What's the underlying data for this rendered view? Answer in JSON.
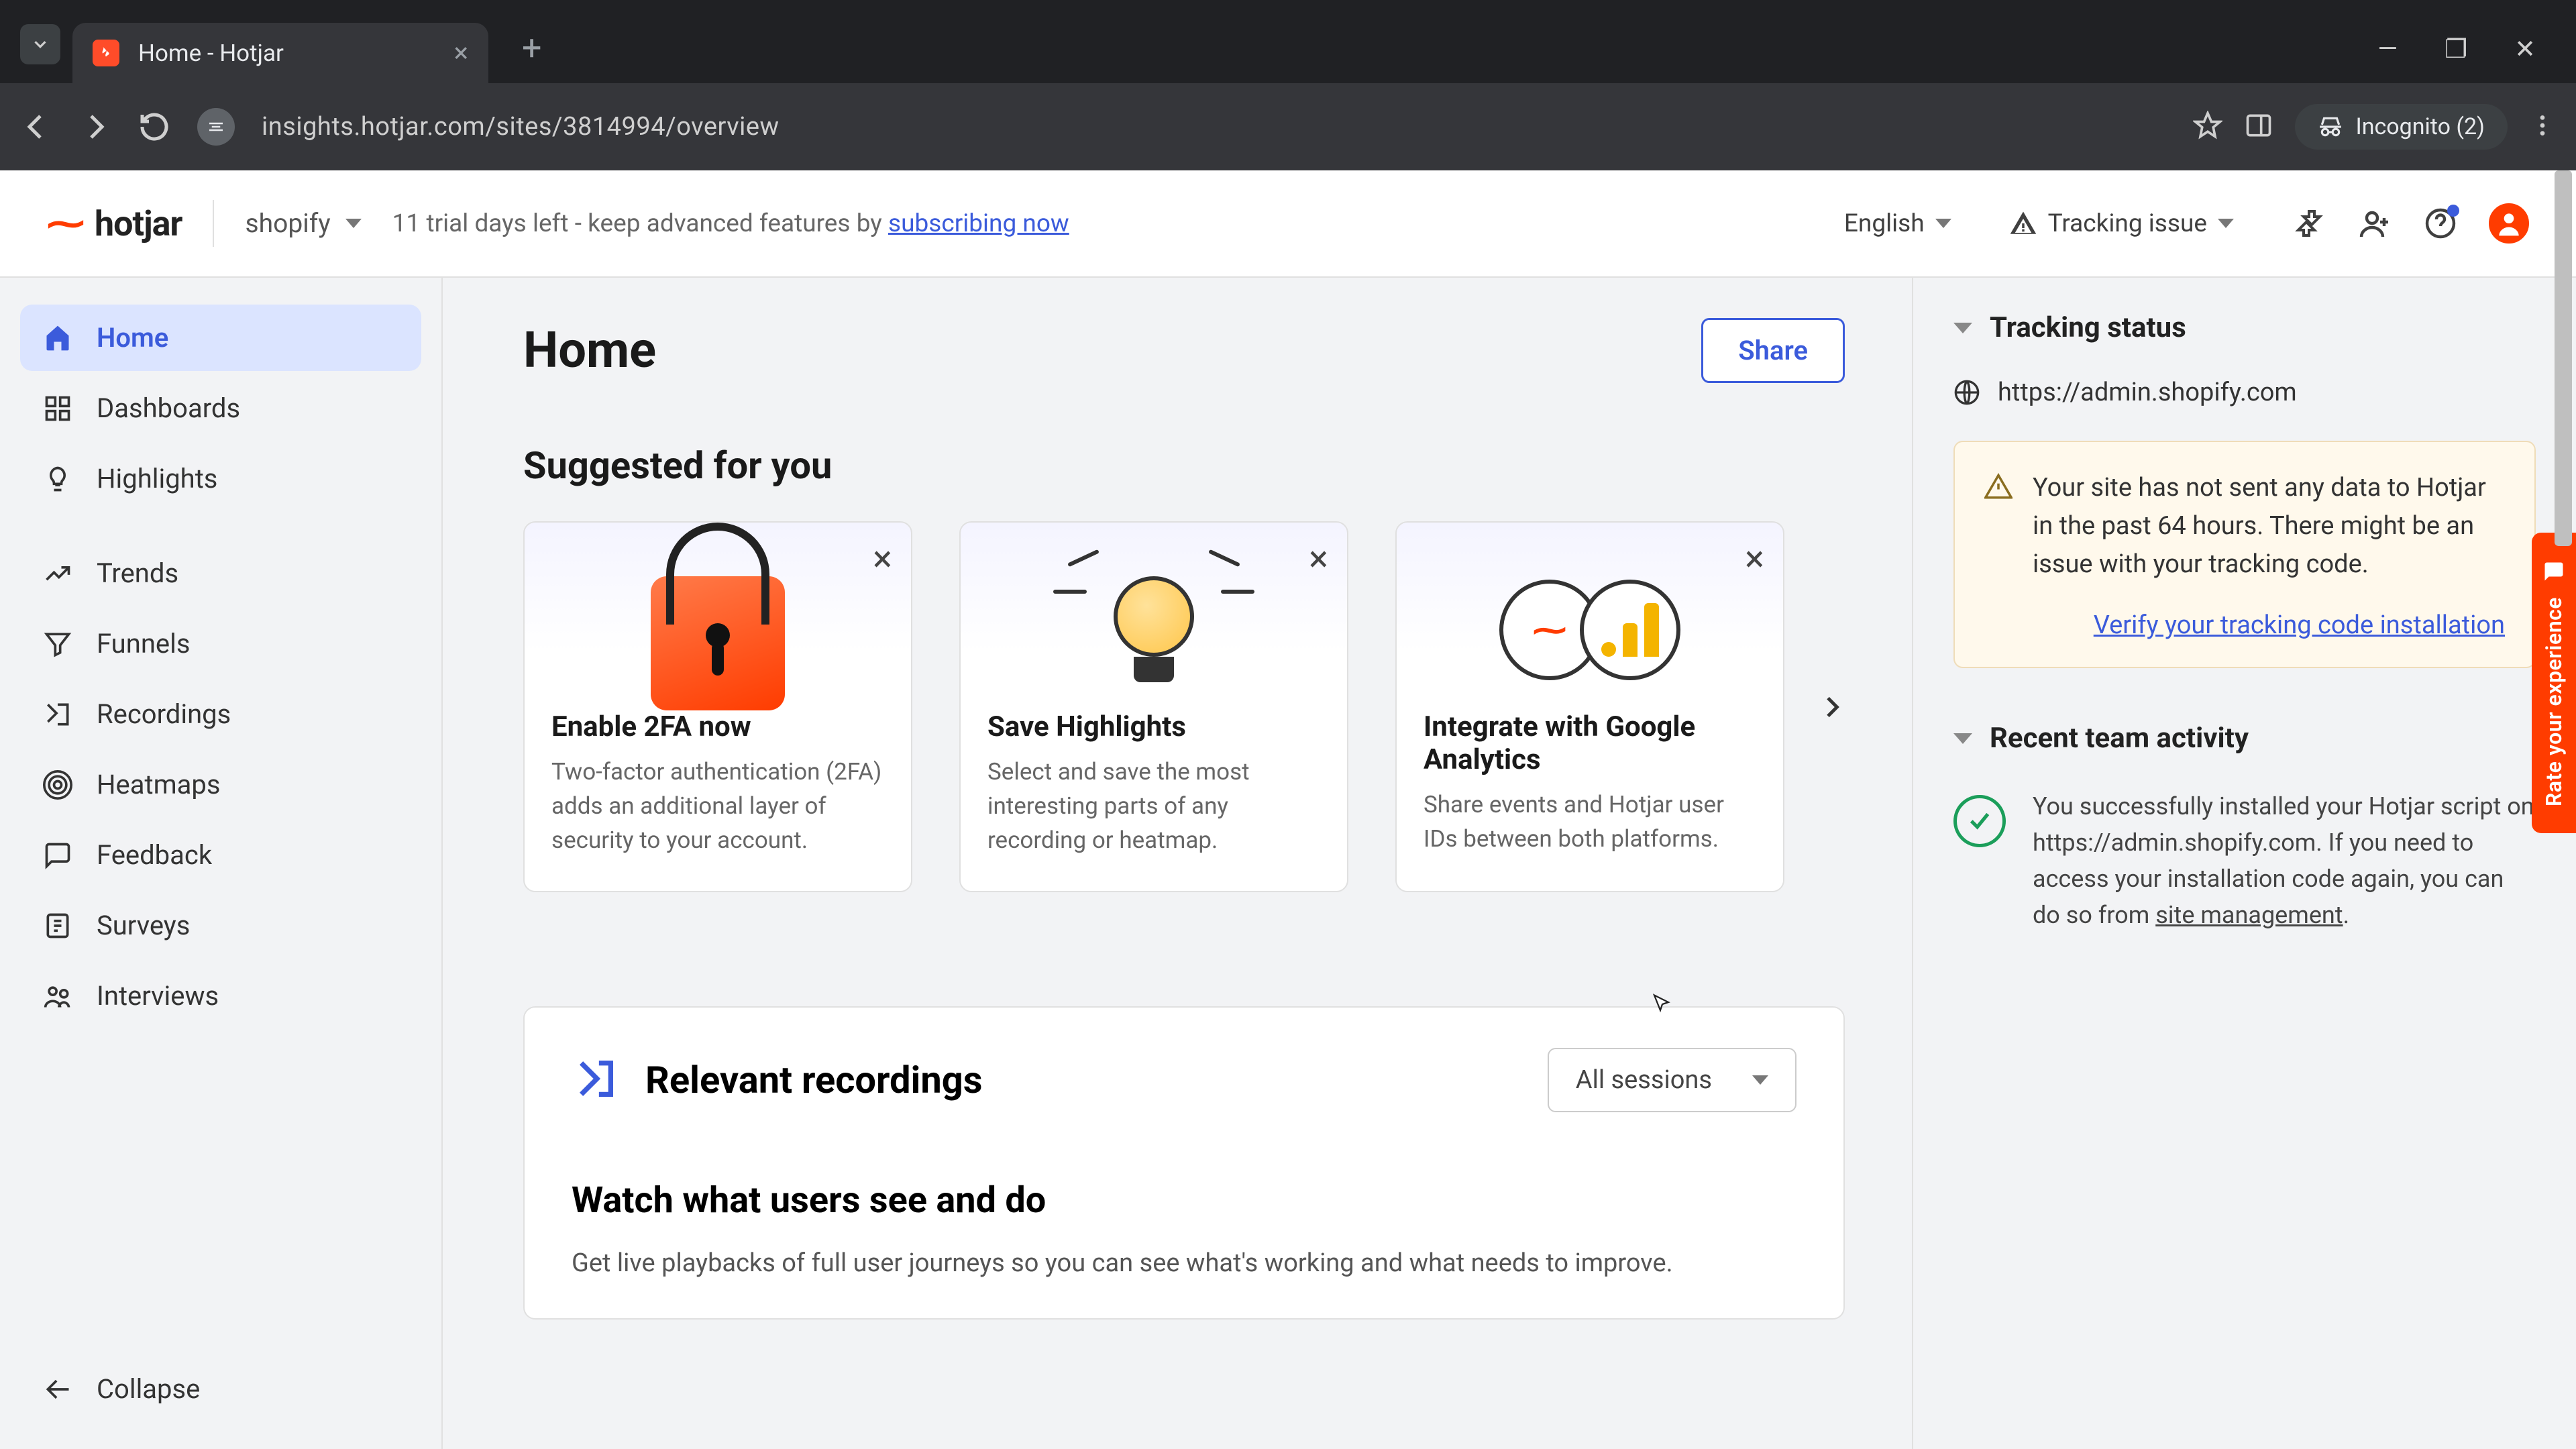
{
  "browser": {
    "tab_title": "Home - Hotjar",
    "url": "insights.hotjar.com/sites/3814994/overview",
    "incognito_label": "Incognito (2)"
  },
  "header": {
    "logo_text": "hotjar",
    "site_selector": "shopify",
    "trial_prefix": "11 trial days left - keep advanced features by ",
    "trial_link": "subscribing now",
    "language": "English",
    "tracking_issue": "Tracking issue"
  },
  "sidebar": {
    "items": [
      {
        "label": "Home"
      },
      {
        "label": "Dashboards"
      },
      {
        "label": "Highlights"
      },
      {
        "label": "Trends"
      },
      {
        "label": "Funnels"
      },
      {
        "label": "Recordings"
      },
      {
        "label": "Heatmaps"
      },
      {
        "label": "Feedback"
      },
      {
        "label": "Surveys"
      },
      {
        "label": "Interviews"
      }
    ],
    "collapse": "Collapse"
  },
  "main": {
    "title": "Home",
    "share": "Share",
    "suggested_heading": "Suggested for you",
    "cards": [
      {
        "title": "Enable 2FA now",
        "desc": "Two-factor authentication (2FA) adds an additional layer of security to your account."
      },
      {
        "title": "Save Highlights",
        "desc": "Select and save the most interesting parts of any recording or heatmap."
      },
      {
        "title": "Integrate with Google Analytics",
        "desc": "Share events and Hotjar user IDs between both platforms."
      }
    ],
    "recordings": {
      "title": "Relevant recordings",
      "selector": "All sessions",
      "sub": "Watch what users see and do",
      "desc": "Get live playbacks of full user journeys so you can see what's working and what needs to improve."
    }
  },
  "right": {
    "tracking_status": "Tracking status",
    "site_url": "https://admin.shopify.com",
    "warn_text": "Your site has not sent any data to Hotjar in the past 64 hours. There might be an issue with your tracking code.",
    "warn_link": "Verify your tracking code installation",
    "recent_activity": "Recent team activity",
    "activity_text_1": "You successfully installed your Hotjar script on https://admin.shopify.com. If you need to access your installation code again, you can do so from ",
    "activity_link": "site management",
    "activity_text_2": "."
  },
  "feedback_tab": "Rate your experience"
}
